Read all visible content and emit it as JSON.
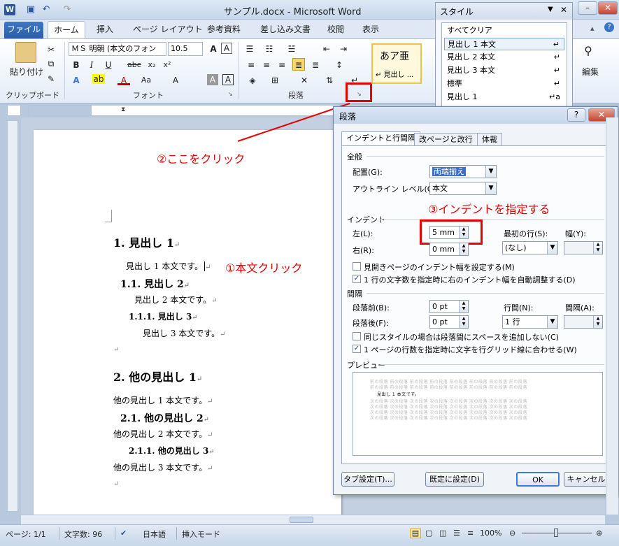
{
  "window": {
    "title": "サンプル.docx - Microsoft Word",
    "app_icon": "W",
    "qa_save": "▣",
    "qa_undo": "↶",
    "qa_redo": "↷"
  },
  "ribbon": {
    "file_tab": "ファイル",
    "tabs": [
      "ホーム",
      "挿入",
      "ページ レイアウト",
      "参考資料",
      "差し込み文書",
      "校閲",
      "表示"
    ],
    "paste": "貼り付け",
    "clipboard_label": "クリップボード",
    "font_name": "ＭＳ 明朝 (本文のフォン",
    "font_size": "10.5",
    "font_label": "フォント",
    "paragraph_label": "段落",
    "style_preview_big": "あア亜",
    "style_preview_small": "↵ 見出し ...",
    "edit_label": "編集"
  },
  "styles_pane": {
    "title": "スタイル",
    "items": [
      {
        "label": "すべてクリア",
        "mark": ""
      },
      {
        "label": "見出し 1 本文",
        "mark": "↵"
      },
      {
        "label": "見出し 2 本文",
        "mark": "↵"
      },
      {
        "label": "見出し 3 本文",
        "mark": "↵"
      },
      {
        "label": "標準",
        "mark": "↵"
      },
      {
        "label": "見出し 1",
        "mark": "↵a"
      }
    ]
  },
  "document": {
    "lines": [
      {
        "text": "1. 見出し 1",
        "cls": "h1"
      },
      {
        "text": "見出し 1 本文です。",
        "cls": "body"
      },
      {
        "text": "1.1. 見出し 2",
        "cls": "h2"
      },
      {
        "text": "見出し 2 本文です。",
        "cls": "body"
      },
      {
        "text": "1.1.1. 見出し 3",
        "cls": "h3"
      },
      {
        "text": "見出し 3 本文です。",
        "cls": "body"
      },
      {
        "text": "",
        "cls": "body"
      },
      {
        "text": "2. 他の見出し 1",
        "cls": "h1"
      },
      {
        "text": "他の見出し 1 本文です。",
        "cls": "body"
      },
      {
        "text": "2.1. 他の見出し 2",
        "cls": "h2"
      },
      {
        "text": "他の見出し 2 本文です。",
        "cls": "body"
      },
      {
        "text": "2.1.1. 他の見出し 3",
        "cls": "h3"
      },
      {
        "text": "他の見出し 3 本文です。",
        "cls": "body"
      },
      {
        "text": "",
        "cls": "body"
      }
    ],
    "para_mark": "↵"
  },
  "annotations": {
    "step1": "①本文クリック",
    "step2": "②ここをクリック",
    "step3": "③インデントを指定する"
  },
  "dialog": {
    "title": "段落",
    "tabs": [
      "インデントと行間隔",
      "改ページと改行",
      "体裁"
    ],
    "general": "全般",
    "alignment_label": "配置(G):",
    "alignment_value": "両端揃え",
    "outline_label": "アウトライン レベル(O):",
    "outline_value": "本文",
    "indent": "インデント",
    "left_label": "左(L):",
    "left_value": "5 mm",
    "right_label": "右(R):",
    "right_value": "0 mm",
    "first_line_label": "最初の行(S):",
    "first_line_value": "(なし)",
    "width_label": "幅(Y):",
    "mirror_indent": "見開きページのインデント幅を設定する(M)",
    "auto_right_indent": "1 行の文字数を指定時に右のインデント幅を自動調整する(D)",
    "spacing": "間隔",
    "before_label": "段落前(B):",
    "before_value": "0 pt",
    "after_label": "段落後(F):",
    "after_value": "0 pt",
    "line_spacing_label": "行間(N):",
    "line_spacing_value": "1 行",
    "at_label": "間隔(A):",
    "no_space_same_style": "同じスタイルの場合は段落間にスペースを追加しない(C)",
    "snap_to_grid": "1 ページの行数を指定時に文字を行グリッド線に合わせる(W)",
    "preview": "プレビュー",
    "preview_prev_text": "前の段落 前の段落 前の段落 前の段落 前の段落 前の段落 前の段落 前の段落",
    "preview_cur_text": "見出し 1 本文です。",
    "preview_next_text": "次の段落 次の段落 次の段落 次の段落 次の段落 次の段落 次の段落 次の段落",
    "tab_settings": "タブ設定(T)...",
    "set_default": "既定に設定(D)",
    "ok": "OK",
    "cancel": "キャンセル",
    "help": "?",
    "close": "✕"
  },
  "statusbar": {
    "page": "ページ: 1/1",
    "words": "文字数: 96",
    "lang": "日本語",
    "mode": "挿入モード",
    "zoom": "100%"
  }
}
